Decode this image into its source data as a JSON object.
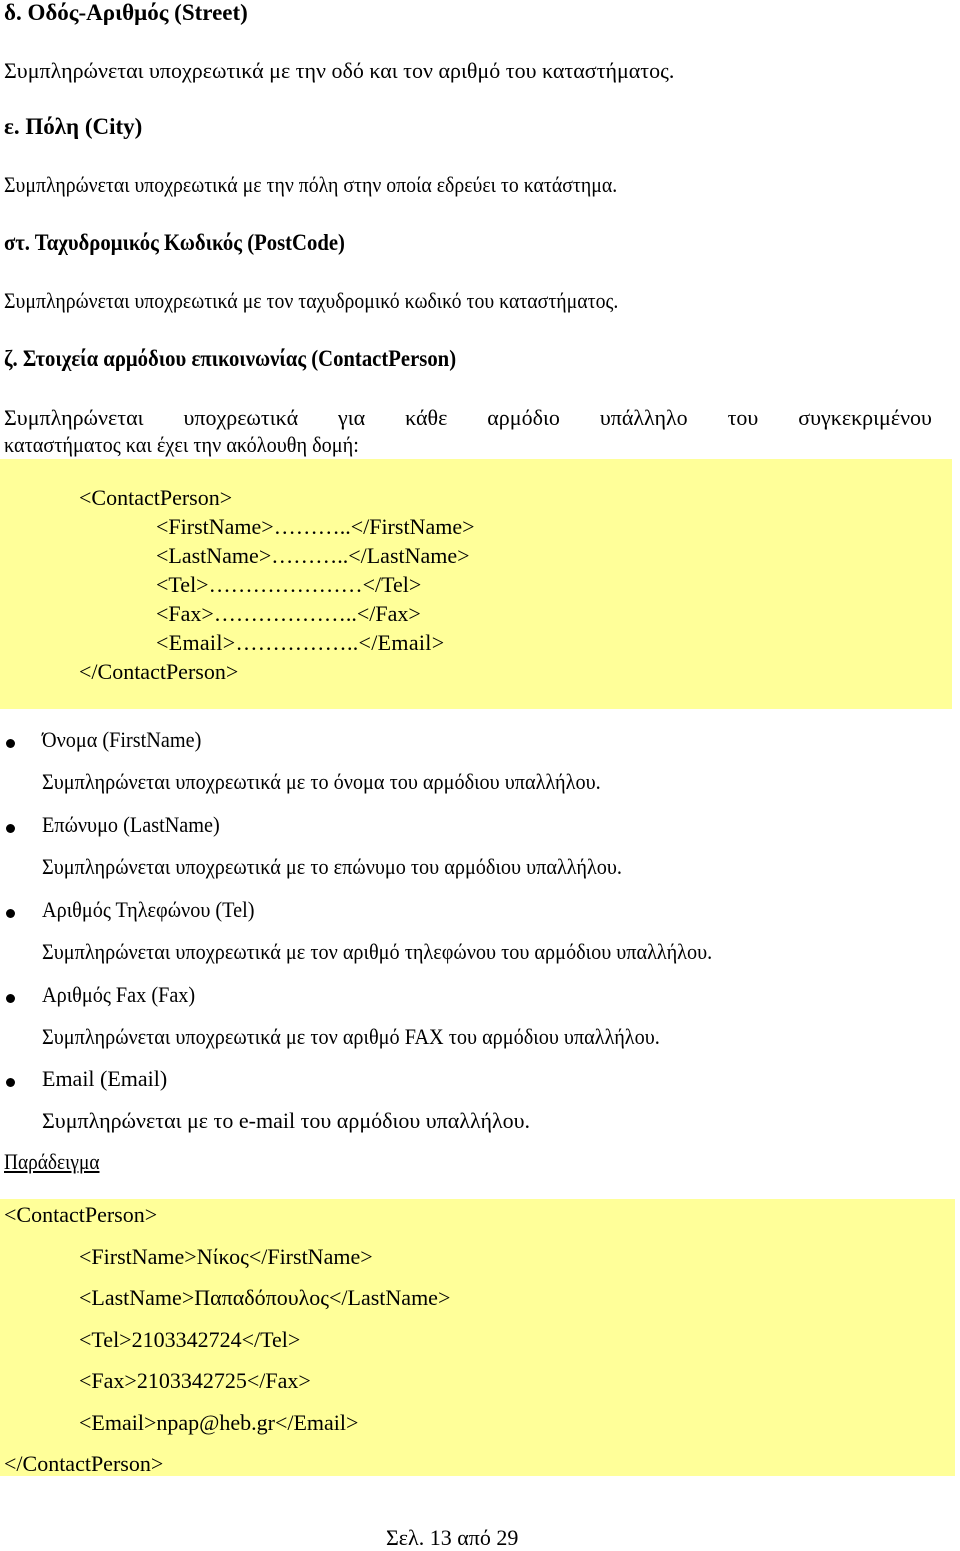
{
  "sections": {
    "street": {
      "heading": "δ. Οδός-Αριθμός (Street)",
      "text": "Συμπληρώνεται υποχρεωτικά με την οδό και  τον αριθμό του καταστήματος."
    },
    "city": {
      "heading": "ε. Πόλη (City)",
      "text": "Συμπληρώνεται υποχρεωτικά με την πόλη στην οποία εδρεύει το κατάστημα."
    },
    "postcode": {
      "heading": "στ. Ταχυδρομικός Κωδικός (PostCode)",
      "text": "Συμπληρώνεται υποχρεωτικά με τον ταχυδρομικό κωδικό του καταστήματος."
    },
    "contact": {
      "heading": "ζ. Στοιχεία αρμόδιου επικοινωνίας (ContactPerson)",
      "text_line1": [
        "Συμπληρώνεται",
        "υποχρεωτικά",
        "για",
        "κάθε",
        "αρμόδιο",
        "υπάλληλο",
        "του",
        "συγκεκριμένου"
      ],
      "text_line2": "καταστήματος και έχει την ακόλουθη δομή:"
    }
  },
  "structure_block": {
    "open": "<ContactPerson>",
    "fields": [
      "<FirstName>………..</FirstName>",
      "<LastName>………..</LastName>",
      "<Tel>…………………</Tel>",
      "<Fax>………………..</Fax>",
      "<Email>……………..</Email>"
    ],
    "close": "</ContactPerson>"
  },
  "field_list": [
    {
      "title": "Όνομα (FirstName)",
      "desc": "Συμπληρώνεται υποχρεωτικά με το όνομα του αρμόδιου υπαλλήλου."
    },
    {
      "title": "Επώνυμο (LastName)",
      "desc": "Συμπληρώνεται υποχρεωτικά με το επώνυμο του αρμόδιου υπαλλήλου."
    },
    {
      "title": "Αριθμός Τηλεφώνου (Tel)",
      "desc": "Συμπληρώνεται υποχρεωτικά με τον αριθμό τηλεφώνου του αρμόδιου υπαλλήλου."
    },
    {
      "title": "Αριθμός Fax (Fax)",
      "desc": "Συμπληρώνεται υποχρεωτικά με τον αριθμό FAX του αρμόδιου υπαλλήλου."
    },
    {
      "title": "Email (Email)",
      "desc": "Συμπληρώνεται με το e-mail του αρμόδιου υπαλλήλου."
    }
  ],
  "example": {
    "label": "Παράδειγμα",
    "open": "<ContactPerson>",
    "fields": [
      "<FirstName>Νίκος</FirstName>",
      "<LastName>Παπαδόπουλος</LastName>",
      "<Tel>2103342724</Tel>",
      "<Fax>2103342725</Fax>",
      "<Email>npap@heb.gr</Email>"
    ],
    "close": "</ContactPerson>"
  },
  "footer": {
    "page_label": "Σελ. 13 από 29"
  },
  "colors": {
    "highlight": "#ffff99",
    "text": "#000000"
  }
}
